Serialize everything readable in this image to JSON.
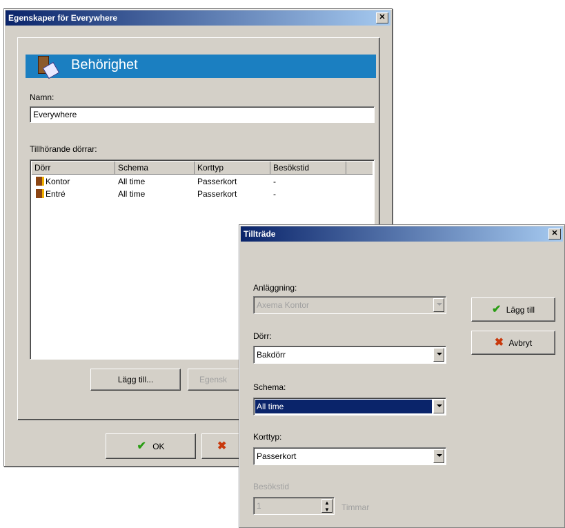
{
  "main_dialog": {
    "title": "Egenskaper för Everywhere",
    "banner_title": "Behörighet",
    "name_label": "Namn:",
    "name_value": "Everywhere",
    "doors_label": "Tillhörande dörrar:",
    "columns": [
      "Dörr",
      "Schema",
      "Korttyp",
      "Besökstid"
    ],
    "rows": [
      {
        "door": "Kontor",
        "schema": "All time",
        "korttyp": "Passerkort",
        "besokstid": "-"
      },
      {
        "door": "Entré",
        "schema": "All time",
        "korttyp": "Passerkort",
        "besokstid": "-"
      }
    ],
    "add_button": "Lägg till...",
    "properties_button": "Egensk",
    "ok_button": "OK"
  },
  "sub_dialog": {
    "title": "Tillträde",
    "facility_label": "Anläggning:",
    "facility_value": "Axema Kontor",
    "door_label": "Dörr:",
    "door_value": "Bakdörr",
    "schedule_label": "Schema:",
    "schedule_value": "All time",
    "cardtype_label": "Korttyp:",
    "cardtype_value": "Passerkort",
    "visit_label": "Besökstid",
    "visit_value": "1",
    "visit_unit": "Timmar",
    "add_button": "Lägg till",
    "cancel_button": "Avbryt"
  },
  "colors": {
    "title_start": "#0a246a",
    "title_end": "#a6caf0",
    "banner": "#1b7fc1",
    "selection": "#0a246a"
  }
}
